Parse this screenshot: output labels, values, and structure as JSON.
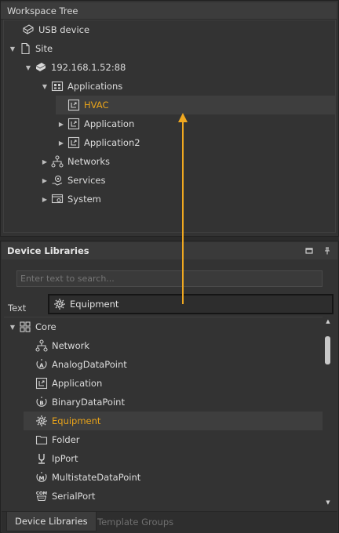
{
  "workspace": {
    "title": "Workspace Tree",
    "items": [
      {
        "label": "USB device",
        "icon": "usb-device-icon",
        "expander": ""
      },
      {
        "label": "Site",
        "icon": "site-icon",
        "expander": "expanded"
      },
      {
        "label": "192.168.1.52:88",
        "icon": "device-icon",
        "expander": "expanded"
      },
      {
        "label": "Applications",
        "icon": "applications-folder-icon",
        "expander": "expanded"
      },
      {
        "label": "HVAC",
        "icon": "application-icon",
        "expander": "",
        "selected": true
      },
      {
        "label": "Application",
        "icon": "application-icon",
        "expander": "collapsed"
      },
      {
        "label": "Application2",
        "icon": "application-icon",
        "expander": "collapsed"
      },
      {
        "label": "Networks",
        "icon": "networks-icon",
        "expander": "collapsed"
      },
      {
        "label": "Services",
        "icon": "services-icon",
        "expander": "collapsed"
      },
      {
        "label": "System",
        "icon": "system-icon",
        "expander": "collapsed"
      }
    ]
  },
  "device_libraries": {
    "title": "Device Libraries",
    "search_placeholder": "Enter text to search...",
    "column_header": "Text",
    "items": [
      {
        "label": "Core",
        "icon": "core-grid-icon",
        "expander": "expanded"
      },
      {
        "label": "Network",
        "icon": "network-icon"
      },
      {
        "label": "AnalogDataPoint",
        "icon": "analog-datapoint-icon"
      },
      {
        "label": "Application",
        "icon": "application-icon"
      },
      {
        "label": "BinaryDataPoint",
        "icon": "binary-datapoint-icon"
      },
      {
        "label": "Equipment",
        "icon": "equipment-gear-icon",
        "selected": true
      },
      {
        "label": "Folder",
        "icon": "folder-icon"
      },
      {
        "label": "IpPort",
        "icon": "ip-port-icon"
      },
      {
        "label": "MultistateDataPoint",
        "icon": "multistate-datapoint-icon"
      },
      {
        "label": "SerialPort",
        "icon": "serial-port-icon"
      }
    ],
    "tabs": [
      "Device Libraries",
      "Template Groups"
    ]
  },
  "drag": {
    "label": "Equipment",
    "icon": "equipment-gear-icon"
  },
  "colors": {
    "accent": "#e8a31a",
    "panel": "#333333",
    "selection": "#3e3e3e"
  }
}
